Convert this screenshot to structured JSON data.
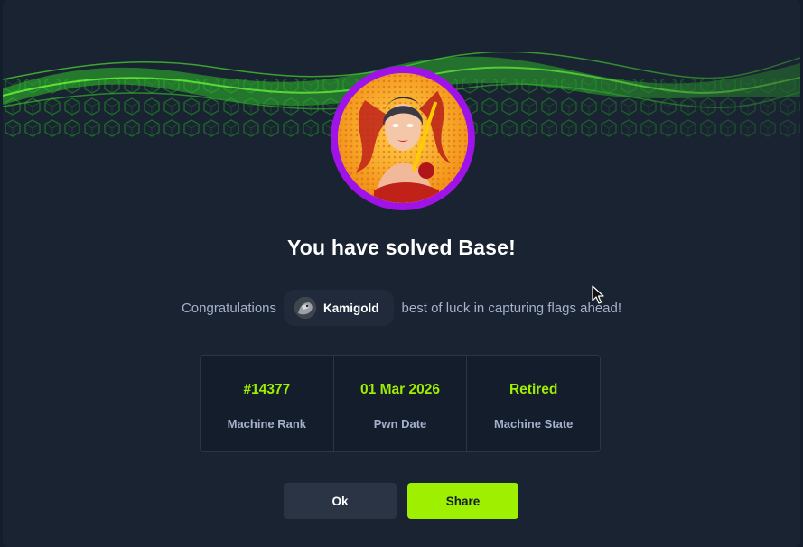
{
  "dialog": {
    "title": "You have solved Base!",
    "congrats_prefix": "Congratulations",
    "username": "Kamigold",
    "congrats_suffix": "best of luck in capturing flags ahead!"
  },
  "stats": [
    {
      "value": "#14377",
      "label": "Machine Rank"
    },
    {
      "value": "01 Mar 2026",
      "label": "Pwn Date"
    },
    {
      "value": "Retired",
      "label": "Machine State"
    }
  ],
  "buttons": {
    "ok_label": "Ok",
    "share_label": "Share"
  },
  "colors": {
    "accent": "#9fef00",
    "background": "#1a2332",
    "avatar_ring": "#9f13e8",
    "muted_text": "#a4b1cd"
  },
  "icons": {
    "machine_avatar": "machine-avatar-icon",
    "user_avatar": "user-avatar-icon",
    "cursor": "mouse-pointer-icon"
  }
}
